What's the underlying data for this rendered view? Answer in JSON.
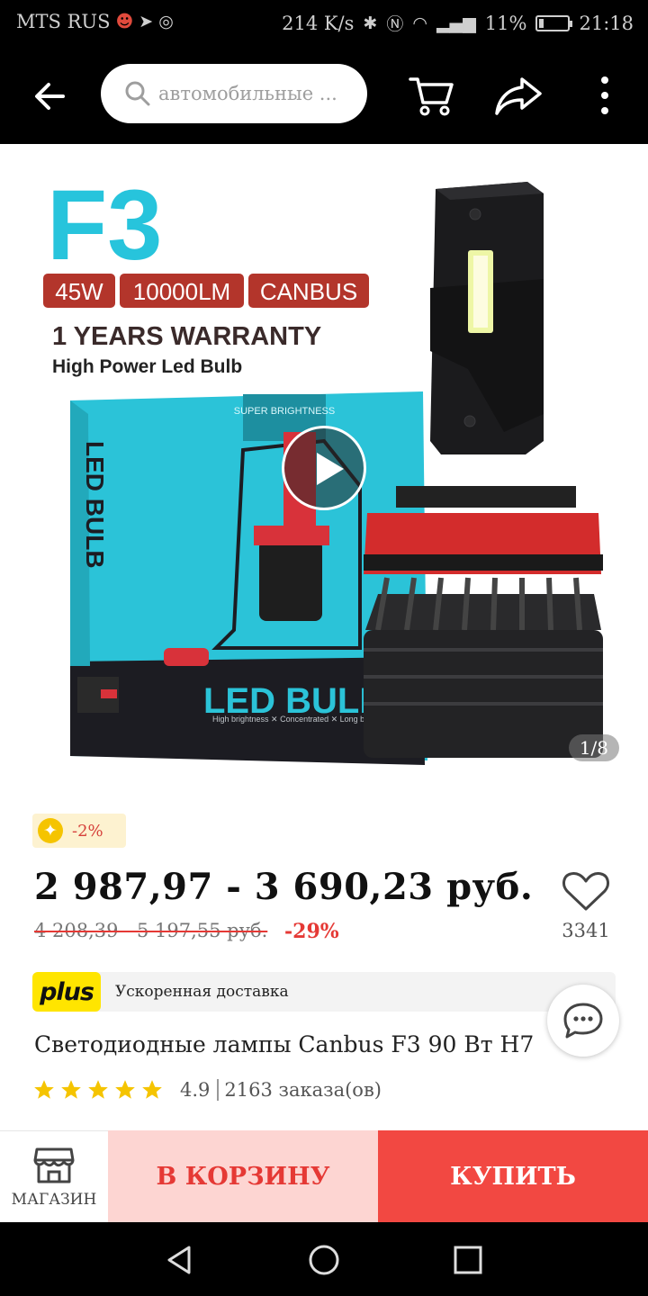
{
  "status_bar": {
    "carrier": "MTS RUS",
    "speed": "214 K/s",
    "battery": "11%",
    "time": "21:18"
  },
  "header": {
    "search_placeholder": "автомобильные ...",
    "icons": [
      "back-arrow-icon",
      "search-icon",
      "cart-icon",
      "share-icon",
      "more-icon"
    ]
  },
  "gallery": {
    "counter": "1/8",
    "product_art": {
      "model": "F3",
      "tags": [
        "45W",
        "10000LM",
        "CANBUS"
      ],
      "warranty": "1 YEARS WARRANTY",
      "subtitle": "High Power Led Bulb",
      "box_label": "LED BULB",
      "box_top": "SUPER BRIGHTNESS",
      "box_side": "LED BULB",
      "box_caption": "High brightness ✕ Concentrated ✕ Long beam range"
    }
  },
  "product": {
    "badge": "-2%",
    "price": "2 987,97 - 3 690,23 руб.",
    "old_price": "4 208,39 - 5 197,55 руб.",
    "discount": "-29%",
    "wishlist_count": "3341",
    "delivery_logo": "plus",
    "delivery_text": "Ускоренная доставка",
    "title": "Светодиодные лампы Canbus F3 90 Вт H7",
    "rating": "4.9",
    "orders": "2163 заказа(ов)",
    "stars": 5
  },
  "actions": {
    "shop_label": "МАГАЗИН",
    "cart_label": "В КОРЗИНУ",
    "buy_label": "КУПИТЬ"
  },
  "colors": {
    "accent_red": "#e53935",
    "buy_red": "#f24842",
    "cart_pink": "#fdd5d2",
    "plus_yellow": "#ffe500",
    "star_gold": "#f5c400",
    "art_cyan": "#2bc3d8",
    "art_tag_red": "#b3352b"
  }
}
